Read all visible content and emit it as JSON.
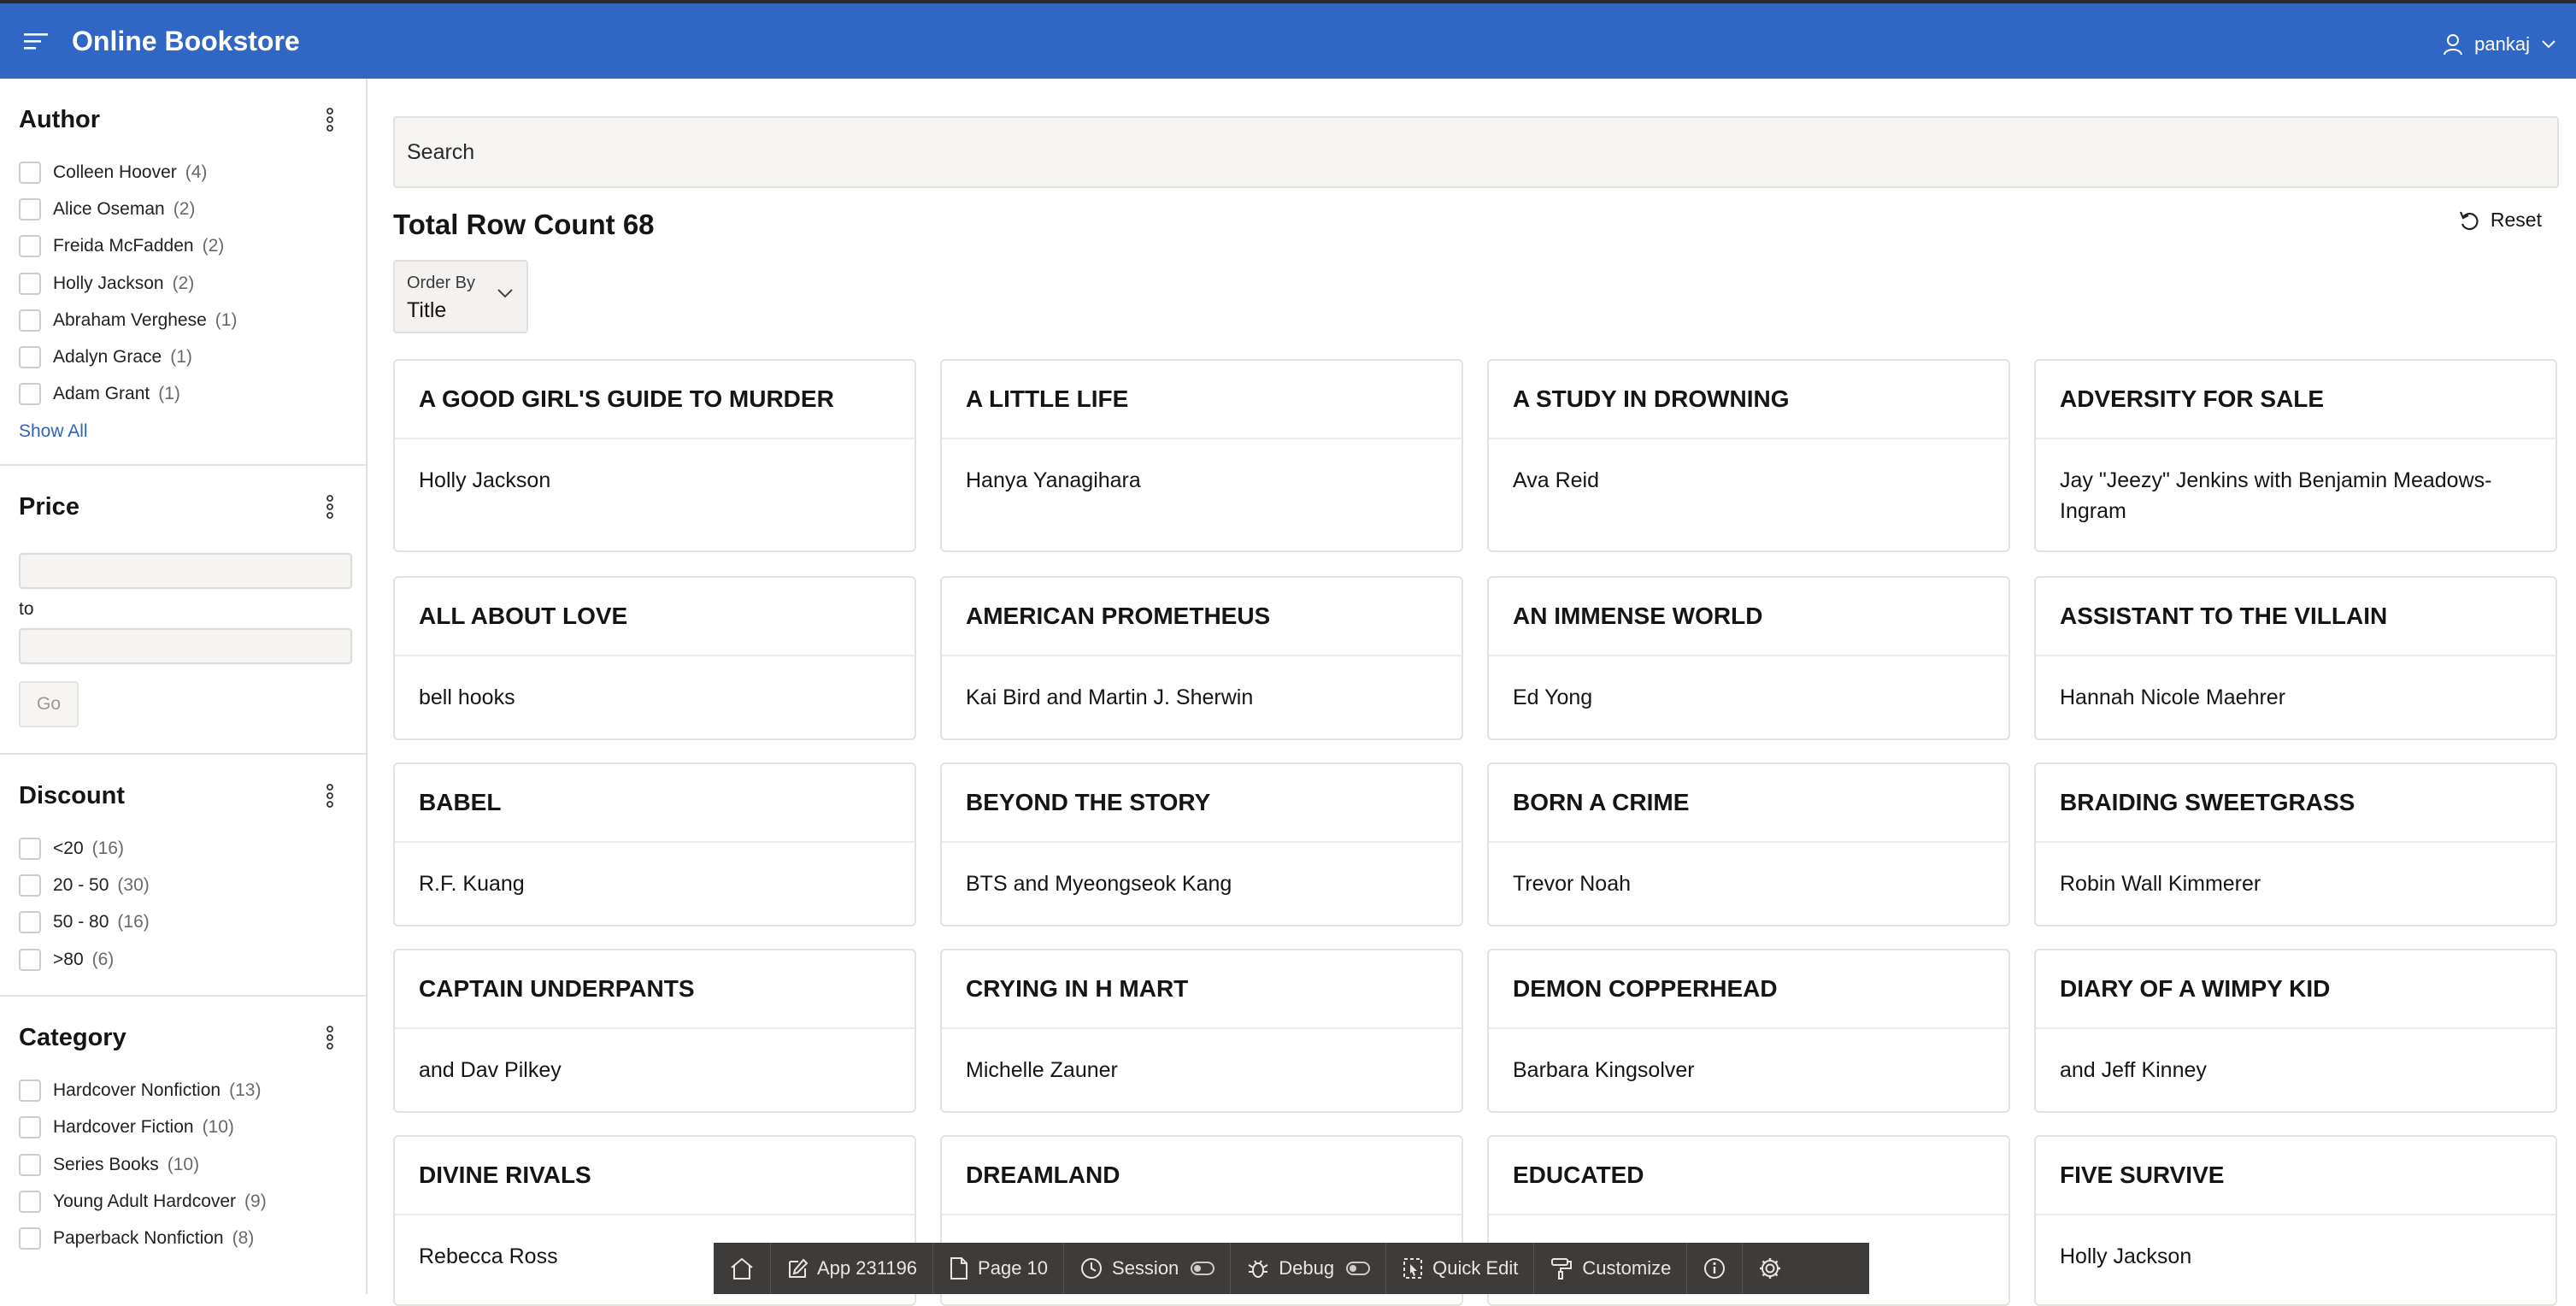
{
  "header": {
    "app_title": "Online Bookstore",
    "user_name": "pankaj"
  },
  "facets": {
    "author": {
      "title": "Author",
      "items": [
        {
          "label": "Colleen Hoover",
          "count": "(4)"
        },
        {
          "label": "Alice Oseman",
          "count": "(2)"
        },
        {
          "label": "Freida McFadden",
          "count": "(2)"
        },
        {
          "label": "Holly Jackson",
          "count": "(2)"
        },
        {
          "label": "Abraham Verghese",
          "count": "(1)"
        },
        {
          "label": "Adalyn Grace",
          "count": "(1)"
        },
        {
          "label": "Adam Grant",
          "count": "(1)"
        }
      ],
      "show_all": "Show All"
    },
    "price": {
      "title": "Price",
      "to_label": "to",
      "go_label": "Go"
    },
    "discount": {
      "title": "Discount",
      "items": [
        {
          "label": "<20",
          "count": "(16)"
        },
        {
          "label": "20 - 50",
          "count": "(30)"
        },
        {
          "label": "50 - 80",
          "count": "(16)"
        },
        {
          "label": ">80",
          "count": "(6)"
        }
      ]
    },
    "category": {
      "title": "Category",
      "items": [
        {
          "label": "Hardcover Nonfiction",
          "count": "(13)"
        },
        {
          "label": "Hardcover Fiction",
          "count": "(10)"
        },
        {
          "label": "Series Books",
          "count": "(10)"
        },
        {
          "label": "Young Adult Hardcover",
          "count": "(9)"
        },
        {
          "label": "Paperback Nonfiction",
          "count": "(8)"
        }
      ]
    }
  },
  "main": {
    "search_placeholder": "Search",
    "row_count": "Total Row Count 68",
    "reset_label": "Reset",
    "order_by": {
      "label": "Order By",
      "value": "Title"
    }
  },
  "cards": [
    {
      "title": "A GOOD GIRL'S GUIDE TO MURDER",
      "author": "Holly Jackson"
    },
    {
      "title": "A LITTLE LIFE",
      "author": "Hanya Yanagihara"
    },
    {
      "title": "A STUDY IN DROWNING",
      "author": "Ava Reid"
    },
    {
      "title": "ADVERSITY FOR SALE",
      "author": "Jay \"Jeezy\" Jenkins with Benjamin Meadows-Ingram"
    },
    {
      "title": "ALL ABOUT LOVE",
      "author": "bell hooks"
    },
    {
      "title": "AMERICAN PROMETHEUS",
      "author": "Kai Bird and Martin J. Sherwin"
    },
    {
      "title": "AN IMMENSE WORLD",
      "author": "Ed Yong"
    },
    {
      "title": "ASSISTANT TO THE VILLAIN",
      "author": "Hannah Nicole Maehrer"
    },
    {
      "title": "BABEL",
      "author": "R.F. Kuang"
    },
    {
      "title": "BEYOND THE STORY",
      "author": "BTS and Myeongseok Kang"
    },
    {
      "title": "BORN A CRIME",
      "author": "Trevor Noah"
    },
    {
      "title": "BRAIDING SWEETGRASS",
      "author": "Robin Wall Kimmerer"
    },
    {
      "title": "CAPTAIN UNDERPANTS",
      "author": "and Dav Pilkey"
    },
    {
      "title": "CRYING IN H MART",
      "author": "Michelle Zauner"
    },
    {
      "title": "DEMON COPPERHEAD",
      "author": "Barbara Kingsolver"
    },
    {
      "title": "DIARY OF A WIMPY KID",
      "author": "and Jeff Kinney"
    },
    {
      "title": "DIVINE RIVALS",
      "author": "Rebecca Ross"
    },
    {
      "title": "DREAMLAND",
      "author": ""
    },
    {
      "title": "EDUCATED",
      "author": ""
    },
    {
      "title": "FIVE SURVIVE",
      "author": "Holly Jackson"
    }
  ],
  "devbar": {
    "app": "App 231196",
    "page": "Page 10",
    "session": "Session",
    "debug": "Debug",
    "quick_edit": "Quick Edit",
    "customize": "Customize"
  },
  "colors": {
    "header_bg": "#3067c4",
    "link": "#2c64c0",
    "devbar_bg": "#3d3c3b"
  }
}
